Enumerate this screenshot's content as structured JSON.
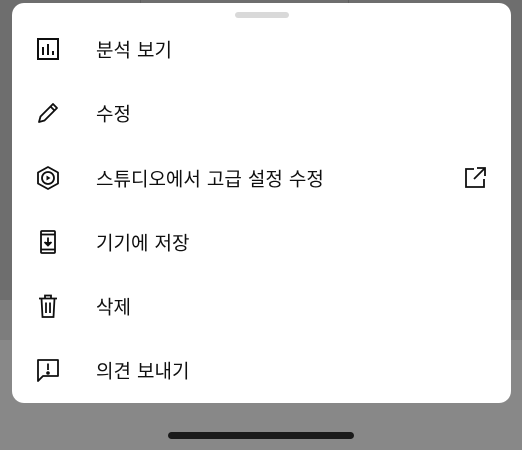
{
  "menu": {
    "items": [
      {
        "label": "분석 보기",
        "icon": "analytics-icon"
      },
      {
        "label": "수정",
        "icon": "pencil-icon"
      },
      {
        "label": "스튜디오에서 고급 설정 수정",
        "icon": "studio-icon",
        "trailing_icon": "external-link-icon"
      },
      {
        "label": "기기에 저장",
        "icon": "download-to-device-icon"
      },
      {
        "label": "삭제",
        "icon": "trash-icon"
      },
      {
        "label": "의견 보내기",
        "icon": "feedback-icon"
      }
    ]
  },
  "colors": {
    "sheet_background": "#ffffff",
    "text": "#0f0f0f",
    "icon": "#0f0f0f",
    "handle": "#d9d9d9",
    "overlay": "#6e6e6e"
  }
}
